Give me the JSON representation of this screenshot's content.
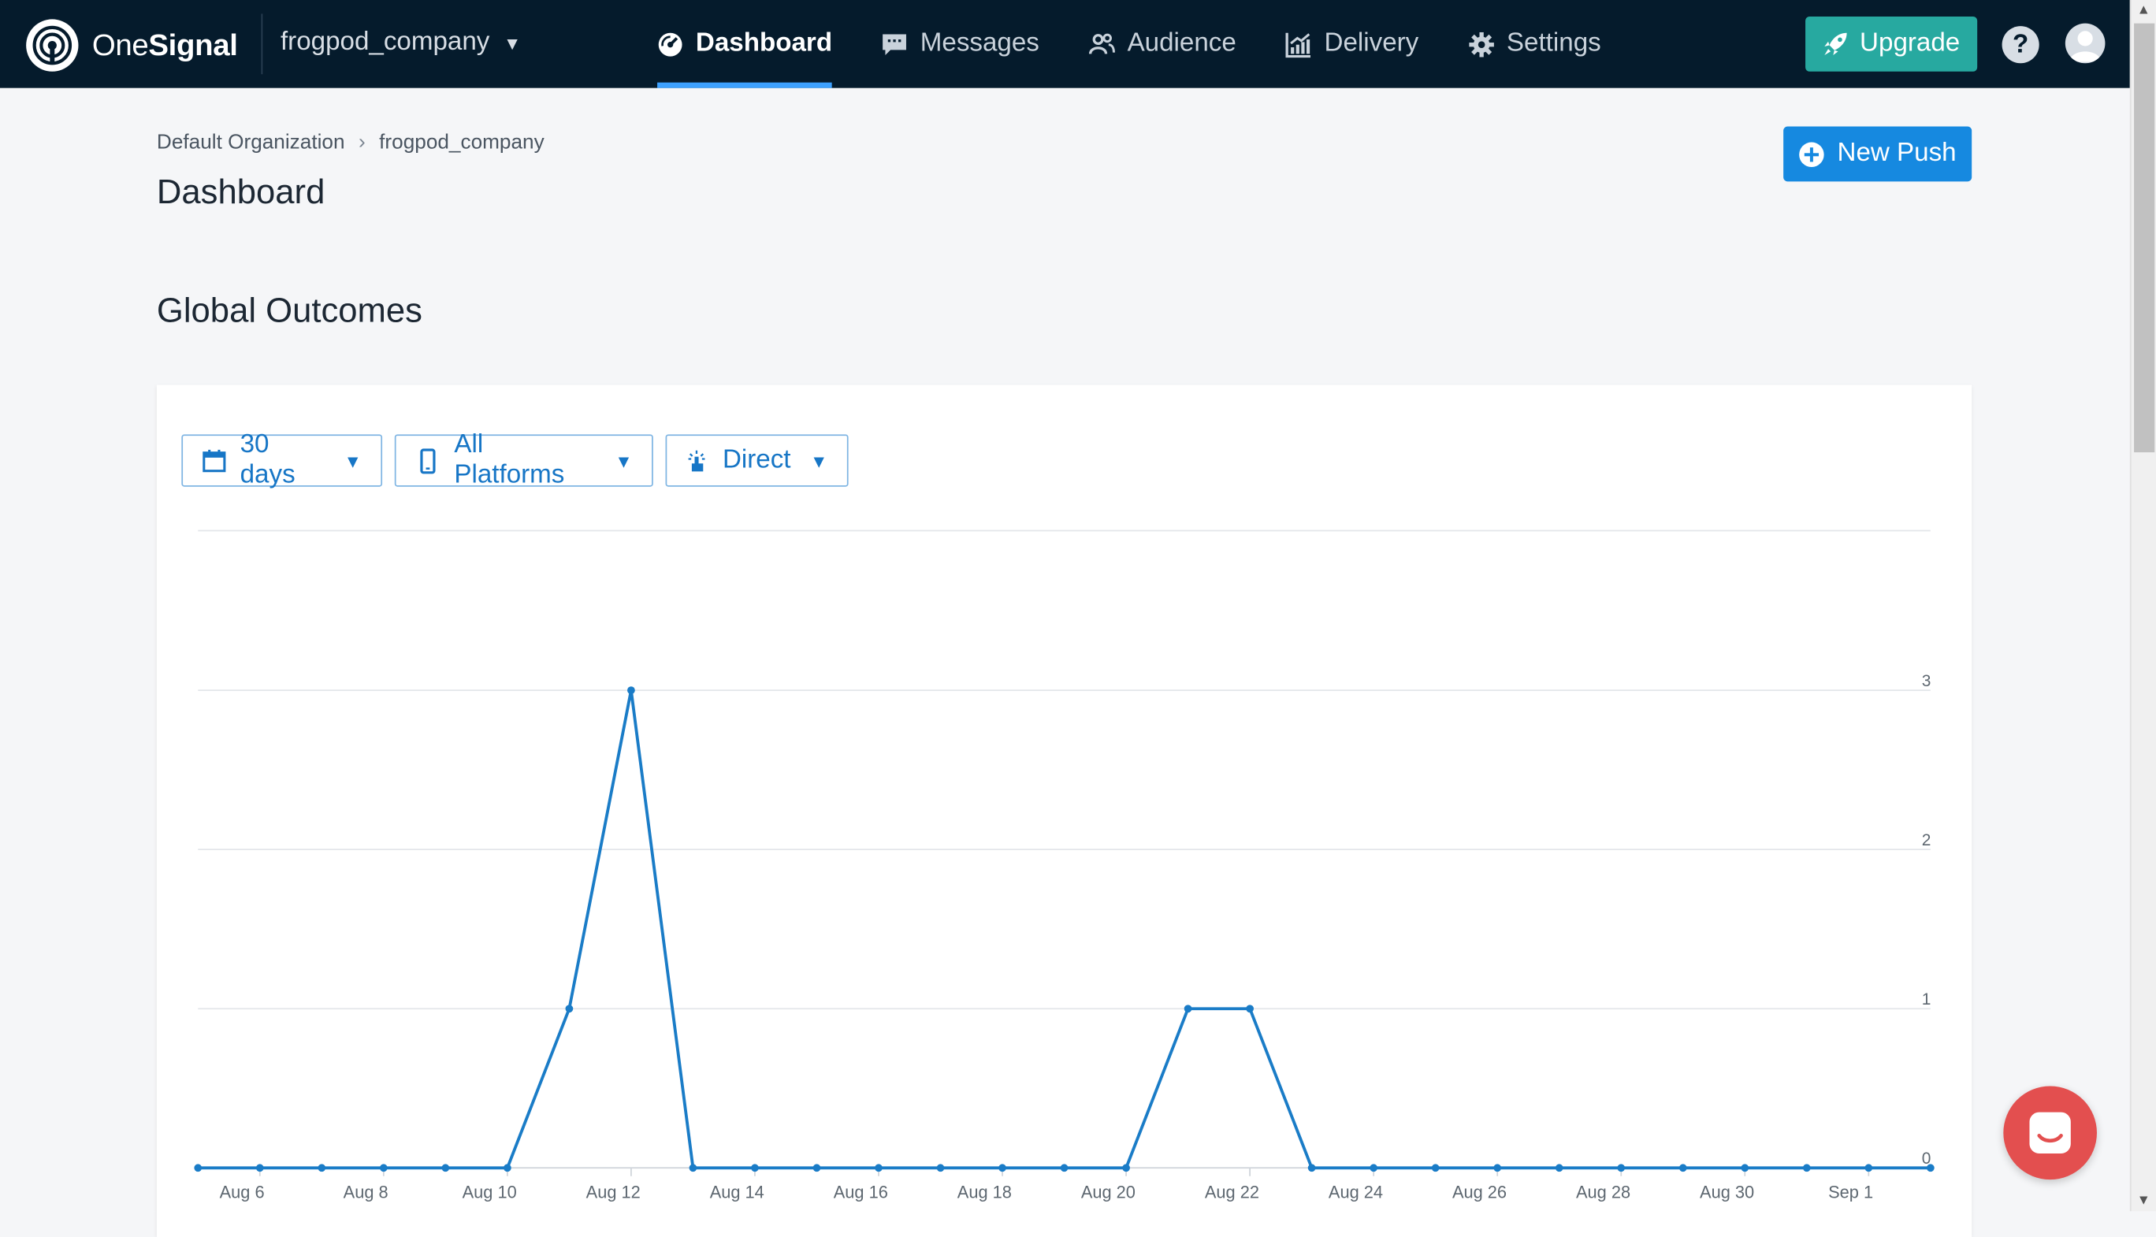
{
  "nav": {
    "brand_one": "One",
    "brand_signal": "Signal",
    "app_name": "frogpod_company",
    "items": [
      {
        "label": "Dashboard",
        "icon": "dashboard-icon",
        "active": true
      },
      {
        "label": "Messages",
        "icon": "message-icon",
        "active": false
      },
      {
        "label": "Audience",
        "icon": "users-icon",
        "active": false
      },
      {
        "label": "Delivery",
        "icon": "chart-icon",
        "active": false
      },
      {
        "label": "Settings",
        "icon": "gear-icon",
        "active": false
      }
    ],
    "upgrade_label": "Upgrade",
    "help_label": "?"
  },
  "breadcrumb": {
    "org": "Default Organization",
    "sep": "›",
    "app": "frogpod_company"
  },
  "page_title": "Dashboard",
  "new_push_label": "New Push",
  "section_title": "Global Outcomes",
  "filters": {
    "range": "30 days",
    "platform": "All Platforms",
    "attribution": "Direct"
  },
  "colors": {
    "accent": "#1689e0",
    "upgrade": "#27a9a0",
    "nav_bg": "#051b2c",
    "line": "#1a7cc7",
    "messenger": "#e34f4f"
  },
  "chart_data": {
    "type": "line",
    "x": [
      "Aug 5",
      "Aug 6",
      "Aug 7",
      "Aug 8",
      "Aug 9",
      "Aug 10",
      "Aug 11",
      "Aug 12",
      "Aug 13",
      "Aug 14",
      "Aug 15",
      "Aug 16",
      "Aug 17",
      "Aug 18",
      "Aug 19",
      "Aug 20",
      "Aug 21",
      "Aug 22",
      "Aug 23",
      "Aug 24",
      "Aug 25",
      "Aug 26",
      "Aug 27",
      "Aug 28",
      "Aug 29",
      "Aug 30",
      "Aug 31",
      "Sep 1",
      "Sep 2"
    ],
    "x_tick_labels": [
      "Aug 6",
      "Aug 8",
      "Aug 10",
      "Aug 12",
      "Aug 14",
      "Aug 16",
      "Aug 18",
      "Aug 20",
      "Aug 22",
      "Aug 24",
      "Aug 26",
      "Aug 28",
      "Aug 30",
      "Sep 1"
    ],
    "values": [
      0,
      0,
      0,
      0,
      0,
      0,
      1,
      3,
      0,
      0,
      0,
      0,
      0,
      0,
      0,
      0,
      1,
      1,
      0,
      0,
      0,
      0,
      0,
      0,
      0,
      0,
      0,
      0,
      0
    ],
    "y_ticks": [
      0,
      1,
      2,
      3
    ],
    "ylim": [
      0,
      4
    ],
    "grid": true,
    "y_axis_side": "right"
  }
}
